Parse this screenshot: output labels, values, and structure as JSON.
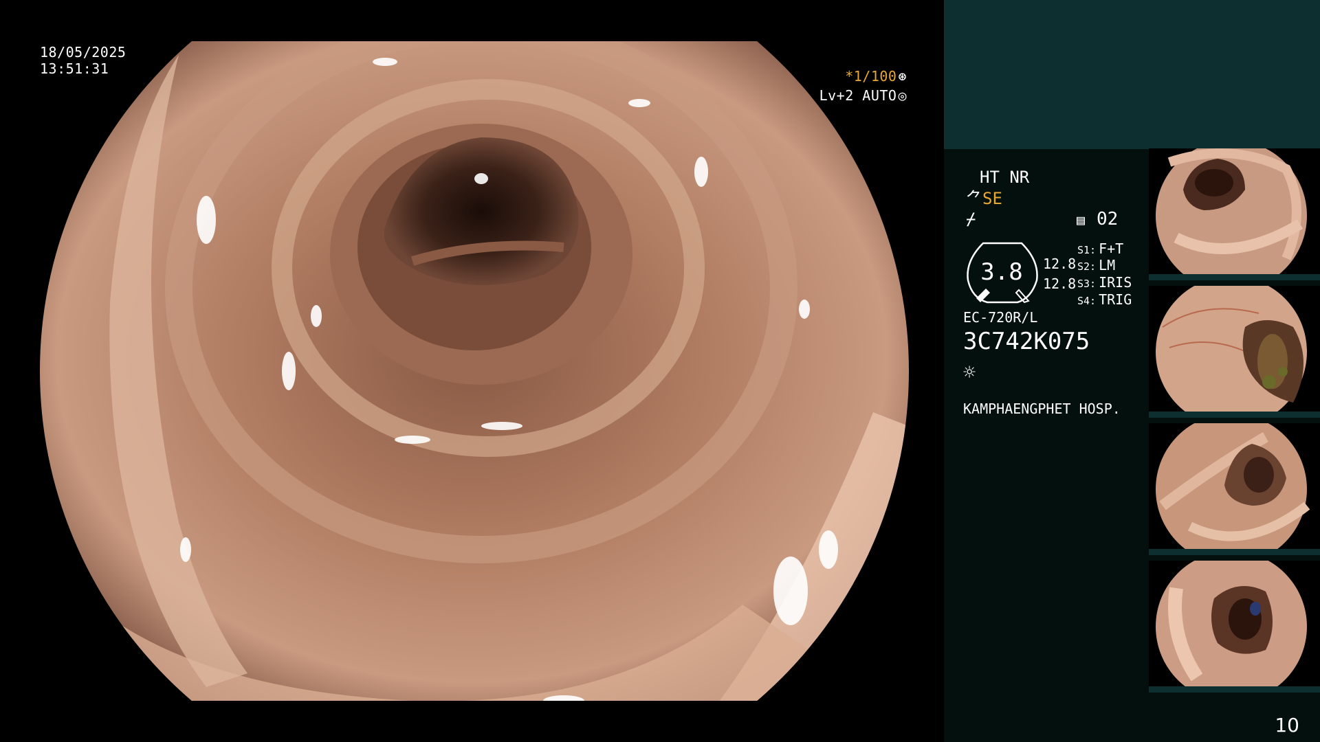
{
  "osd": {
    "date": "18/05/2025",
    "time": "13:51:31",
    "shutter": "*1/100",
    "shutter_glyph": "⊛",
    "level": "Lv+2 AUTO",
    "level_glyph": "◎"
  },
  "panel": {
    "mode_ht": "HT NR",
    "mode_se_glyph": "⺈",
    "mode_se": "SE",
    "mode_flash": "⌿",
    "doc_icon": "▤",
    "doc_number": "02",
    "gauge_value": "3.8",
    "gauge_v1": "12.8",
    "gauge_v2": "12.8",
    "switches": [
      {
        "key": "S1:",
        "value": "F+T"
      },
      {
        "key": "S2:",
        "value": "LM"
      },
      {
        "key": "S3:",
        "value": "IRIS"
      },
      {
        "key": "S4:",
        "value": "TRIG"
      }
    ],
    "scope_model": "EC-720R/L",
    "scope_serial": "3C742K075",
    "light_icon": "☼",
    "hospital": "KAMPHAENGPHET HOSP."
  },
  "page_number": "10",
  "colors": {
    "panel_top": "#0e2f2f",
    "panel_bg": "#04100e",
    "accent_amber": "#e8a832",
    "mucosa": "#b88a70"
  }
}
